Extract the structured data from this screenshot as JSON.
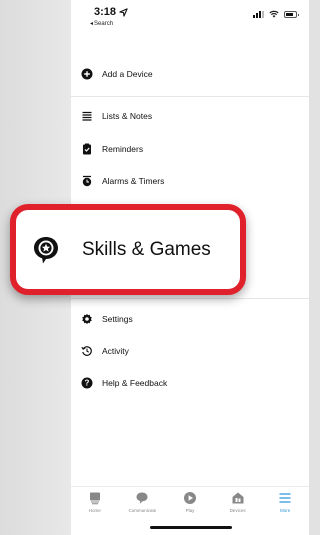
{
  "status_bar": {
    "time": "3:18",
    "back_label": "Search"
  },
  "menu": {
    "items": [
      {
        "label": "Add a Device",
        "icon": "plus-circle-icon"
      },
      {
        "label": "Lists & Notes",
        "icon": "list-icon"
      },
      {
        "label": "Reminders",
        "icon": "clipboard-check-icon"
      },
      {
        "label": "Alarms & Timers",
        "icon": "alarm-clock-icon"
      },
      {
        "label": "Settings",
        "icon": "gear-icon"
      },
      {
        "label": "Activity",
        "icon": "history-icon"
      },
      {
        "label": "Help & Feedback",
        "icon": "help-circle-icon"
      }
    ]
  },
  "highlight": {
    "label": "Skills & Games",
    "icon": "star-speech-bubble-icon",
    "border_color": "#e0202a"
  },
  "tabbar": {
    "tabs": [
      {
        "label": "Home",
        "icon": "home-card-icon"
      },
      {
        "label": "Communicate",
        "icon": "chat-bubble-icon"
      },
      {
        "label": "Play",
        "icon": "play-circle-icon"
      },
      {
        "label": "Devices",
        "icon": "house-devices-icon"
      },
      {
        "label": "More",
        "icon": "hamburger-icon",
        "active": true
      }
    ],
    "active_color": "#2f98d8"
  }
}
